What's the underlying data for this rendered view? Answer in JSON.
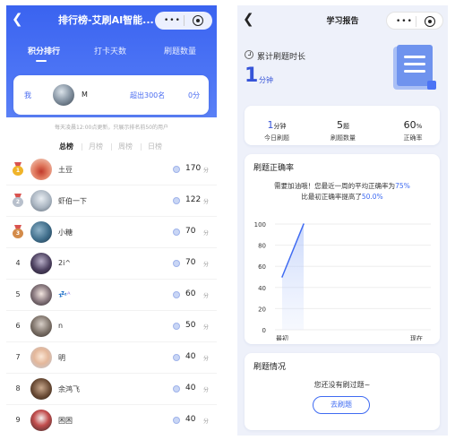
{
  "leaderboard": {
    "title": "排行榜-艾刷AI智能...",
    "tabs": [
      {
        "label": "积分排行",
        "active": true
      },
      {
        "label": "打卡天数",
        "active": false
      },
      {
        "label": "刷题数量",
        "active": false
      }
    ],
    "my_card": {
      "me_label": "我",
      "name": "M",
      "beyond_text": "超出300名",
      "score_text": "0分"
    },
    "notice": "每天凌晨12:00点更新，只展示排名前50的用户",
    "sub_tabs": [
      {
        "label": "总榜",
        "active": true
      },
      {
        "label": "月榜",
        "active": false
      },
      {
        "label": "周榜",
        "active": false
      },
      {
        "label": "日榜",
        "active": false
      }
    ],
    "score_unit": "分",
    "rows": [
      {
        "rank": "1",
        "name": "土豆",
        "score": "170",
        "medal": "gold"
      },
      {
        "rank": "2",
        "name": "虾伯一下",
        "score": "122",
        "medal": "silver"
      },
      {
        "rank": "3",
        "name": "小糖",
        "score": "70",
        "medal": "bronze"
      },
      {
        "rank": "4",
        "name": "2i^",
        "score": "70",
        "medal": ""
      },
      {
        "rank": "5",
        "name": "💤ᴬ",
        "score": "60",
        "medal": ""
      },
      {
        "rank": "6",
        "name": "n",
        "score": "50",
        "medal": ""
      },
      {
        "rank": "7",
        "name": "明",
        "score": "40",
        "medal": ""
      },
      {
        "rank": "8",
        "name": "余鸿飞",
        "score": "40",
        "medal": ""
      },
      {
        "rank": "9",
        "name": "困困",
        "score": "40",
        "medal": ""
      }
    ]
  },
  "report": {
    "title": "学习报告",
    "total_label": "累计刷题时长",
    "total_value": "1",
    "total_unit": "分钟",
    "stats": [
      {
        "value": "1",
        "unit": "分钟",
        "label": "今日刷题",
        "blue": true
      },
      {
        "value": "5",
        "unit": "题",
        "label": "刷题数量",
        "blue": false
      },
      {
        "value": "60",
        "unit": "%",
        "label": "正确率",
        "blue": false
      }
    ],
    "accuracy_title": "刷题正确率",
    "msg_prefix": "需要加油哦！您最近一周的平均正确率为",
    "msg_avg": "75%",
    "msg2_prefix": "比最初正确率提高了",
    "msg2_val": "50.0%",
    "practice_title": "刷题情况",
    "empty_text": "您还没有刷过题~",
    "button_label": "去刷题"
  },
  "colors": {
    "primary": "#4c74f5",
    "accent_blue": "#3f6bf2",
    "gold": "#f0b429",
    "silver": "#b8c0cc",
    "bronze": "#d38b4a"
  },
  "chart_data": {
    "type": "area",
    "x": [
      "最初",
      "现在"
    ],
    "values": [
      50,
      100
    ],
    "ylim": [
      0,
      100
    ],
    "yticks": [
      "100",
      "80",
      "60",
      "40",
      "20",
      "0"
    ],
    "grid": true
  }
}
